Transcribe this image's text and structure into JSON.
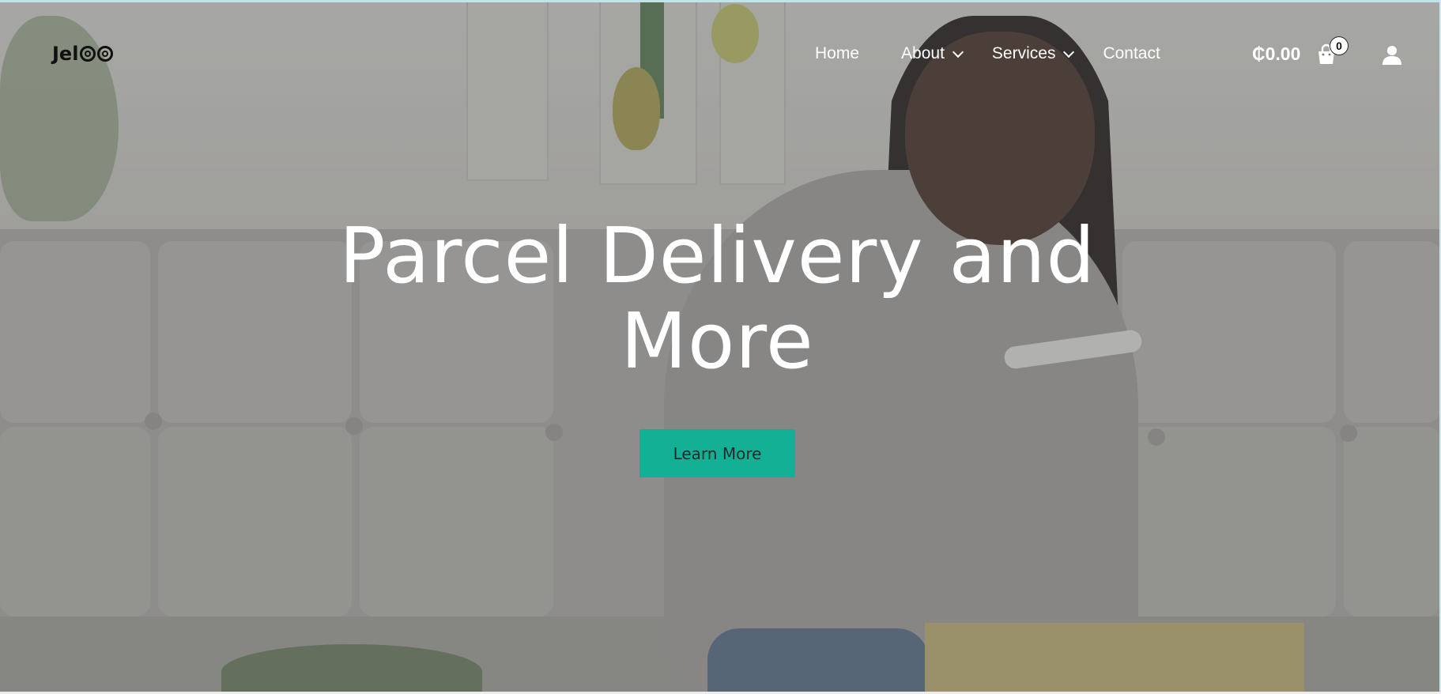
{
  "brand": {
    "logo_text": "Jel"
  },
  "nav": {
    "items": [
      {
        "label": "Home",
        "has_dropdown": false
      },
      {
        "label": "About",
        "has_dropdown": true
      },
      {
        "label": "Services",
        "has_dropdown": true
      },
      {
        "label": "Contact",
        "has_dropdown": false
      }
    ]
  },
  "cart": {
    "total": "₵0.00",
    "count": "0",
    "icon": "shopping-bag-icon"
  },
  "account": {
    "icon": "user-icon"
  },
  "hero": {
    "title": "Parcel Delivery and More",
    "cta_label": "Learn More"
  },
  "colors": {
    "accent": "#14b096",
    "nav_text": "#ffffff",
    "overlay": "#505050"
  }
}
